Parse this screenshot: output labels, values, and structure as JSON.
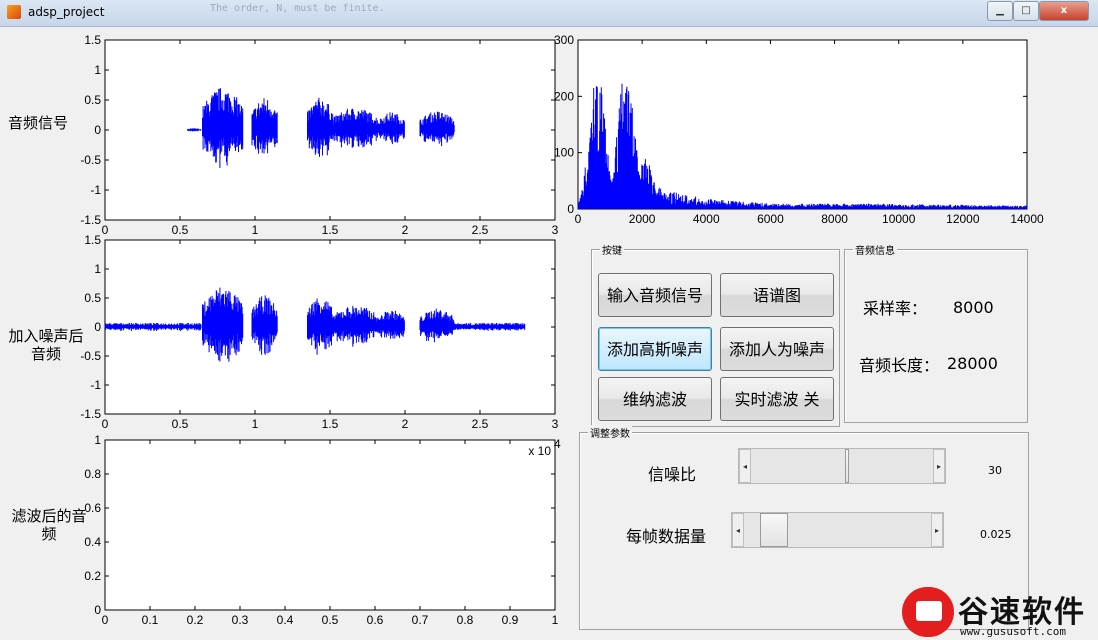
{
  "window": {
    "title": "adsp_project",
    "background_title_text": "The order, N, must be finite.",
    "minimize_label": "▁",
    "maximize_label": "□",
    "close_label": "x"
  },
  "plots": {
    "original": {
      "ylabel": "音频信号",
      "xlim": [
        0,
        3
      ],
      "ylim": [
        -1.5,
        1.5
      ],
      "xticks": [
        "0",
        "0.5",
        "1",
        "1.5",
        "2",
        "2.5",
        "3"
      ],
      "yticks": [
        "1.5",
        "1",
        "0.5",
        "0",
        "-0.5",
        "-1",
        "-1.5"
      ]
    },
    "noisy": {
      "ylabel_lines": [
        "加入噪声后",
        "音频"
      ],
      "xlim": [
        0,
        3
      ],
      "ylim": [
        -1.5,
        1.5
      ],
      "xticks": [
        "0",
        "0.5",
        "1",
        "1.5",
        "2",
        "2.5",
        "3"
      ],
      "yticks": [
        "1.5",
        "1",
        "0.5",
        "0",
        "-0.5",
        "-1",
        "-1.5"
      ]
    },
    "filtered": {
      "ylabel_lines": [
        "滤波后的音",
        "频"
      ],
      "xlim": [
        0,
        1
      ],
      "ylim": [
        0,
        1
      ],
      "xticks": [
        "0",
        "0.1",
        "0.2",
        "0.3",
        "0.4",
        "0.5",
        "0.6",
        "0.7",
        "0.8",
        "0.9",
        "1"
      ],
      "yticks": [
        "1",
        "0.8",
        "0.6",
        "0.4",
        "0.2",
        "0"
      ],
      "exponent_label": "x 10",
      "exponent_power": "4"
    },
    "spectrum": {
      "xlim": [
        0,
        14000
      ],
      "ylim": [
        0,
        300
      ],
      "xticks": [
        "0",
        "2000",
        "4000",
        "6000",
        "8000",
        "10000",
        "12000",
        "14000"
      ],
      "yticks": [
        "300",
        "200",
        "100",
        "0"
      ]
    }
  },
  "chart_data": [
    {
      "type": "line",
      "title": "",
      "ylabel": "音频信号",
      "xlim": [
        0,
        3
      ],
      "ylim": [
        -1.5,
        1.5
      ],
      "series": [
        {
          "color": "#0000ff",
          "segments": [
            {
              "x_start": 0.0,
              "x_end": 0.55,
              "amplitude": 0.0
            },
            {
              "x_start": 0.55,
              "x_end": 0.64,
              "amplitude": 0.03
            },
            {
              "x_start": 0.65,
              "x_end": 0.92,
              "amplitude": 0.72
            },
            {
              "x_start": 0.98,
              "x_end": 1.15,
              "amplitude": 0.55
            },
            {
              "x_start": 1.35,
              "x_end": 1.52,
              "amplitude": 0.55
            },
            {
              "x_start": 1.52,
              "x_end": 1.82,
              "amplitude": 0.38
            },
            {
              "x_start": 1.82,
              "x_end": 2.0,
              "amplitude": 0.3
            },
            {
              "x_start": 2.1,
              "x_end": 2.33,
              "amplitude": 0.32
            },
            {
              "x_start": 2.33,
              "x_end": 2.8,
              "amplitude": 0.0
            }
          ]
        }
      ]
    },
    {
      "type": "line",
      "title": "",
      "ylabel": "加入噪声后音频",
      "xlim": [
        0,
        3
      ],
      "ylim": [
        -1.5,
        1.5
      ],
      "series": [
        {
          "color": "#0000ff",
          "noise_amplitude": 0.07,
          "segments": [
            {
              "x_start": 0.0,
              "x_end": 0.64,
              "amplitude": 0.07
            },
            {
              "x_start": 0.65,
              "x_end": 0.92,
              "amplitude": 0.72
            },
            {
              "x_start": 0.98,
              "x_end": 1.15,
              "amplitude": 0.55
            },
            {
              "x_start": 1.35,
              "x_end": 1.52,
              "amplitude": 0.55
            },
            {
              "x_start": 1.52,
              "x_end": 1.82,
              "amplitude": 0.38
            },
            {
              "x_start": 1.82,
              "x_end": 2.0,
              "amplitude": 0.3
            },
            {
              "x_start": 2.1,
              "x_end": 2.33,
              "amplitude": 0.32
            },
            {
              "x_start": 2.33,
              "x_end": 2.8,
              "amplitude": 0.07
            }
          ]
        }
      ]
    },
    {
      "type": "line",
      "title": "",
      "xlim": [
        0,
        14000
      ],
      "ylim": [
        0,
        300
      ],
      "series": [
        {
          "color": "#0000ff",
          "peaks": [
            {
              "x": 600,
              "y": 250
            },
            {
              "x": 1500,
              "y": 265
            },
            {
              "x": 2100,
              "y": 90
            },
            {
              "x": 2500,
              "y": 40
            }
          ],
          "floor": [
            {
              "x": 0,
              "y": 5
            },
            {
              "x": 3000,
              "y": 25
            },
            {
              "x": 4000,
              "y": 15
            },
            {
              "x": 6000,
              "y": 8
            },
            {
              "x": 9000,
              "y": 8
            },
            {
              "x": 14000,
              "y": 5
            }
          ]
        }
      ]
    },
    {
      "type": "line",
      "title": "",
      "ylabel": "滤波后的音频",
      "xlim": [
        0,
        1
      ],
      "ylim": [
        0,
        1
      ],
      "series": []
    }
  ],
  "buttons_panel": {
    "title": "按键",
    "buttons": [
      "输入音频信号",
      "语谱图",
      "添加高斯噪声",
      "添加人为噪声",
      "维纳滤波",
      "实时滤波 关"
    ]
  },
  "audio_info": {
    "title": "音频信息",
    "sample_rate_label": "采样率：",
    "sample_rate_value": "8000",
    "length_label": "音频长度：",
    "length_value": "28000"
  },
  "params": {
    "title": "调整参数",
    "snr_label": "信噪比",
    "snr_value": "30",
    "snr_fraction": 0.52,
    "frame_label": "每帧数据量",
    "frame_value": "0.025",
    "frame_fraction": 0.1
  },
  "watermark": {
    "name": "谷速软件",
    "url": "www.gususoft.com"
  }
}
